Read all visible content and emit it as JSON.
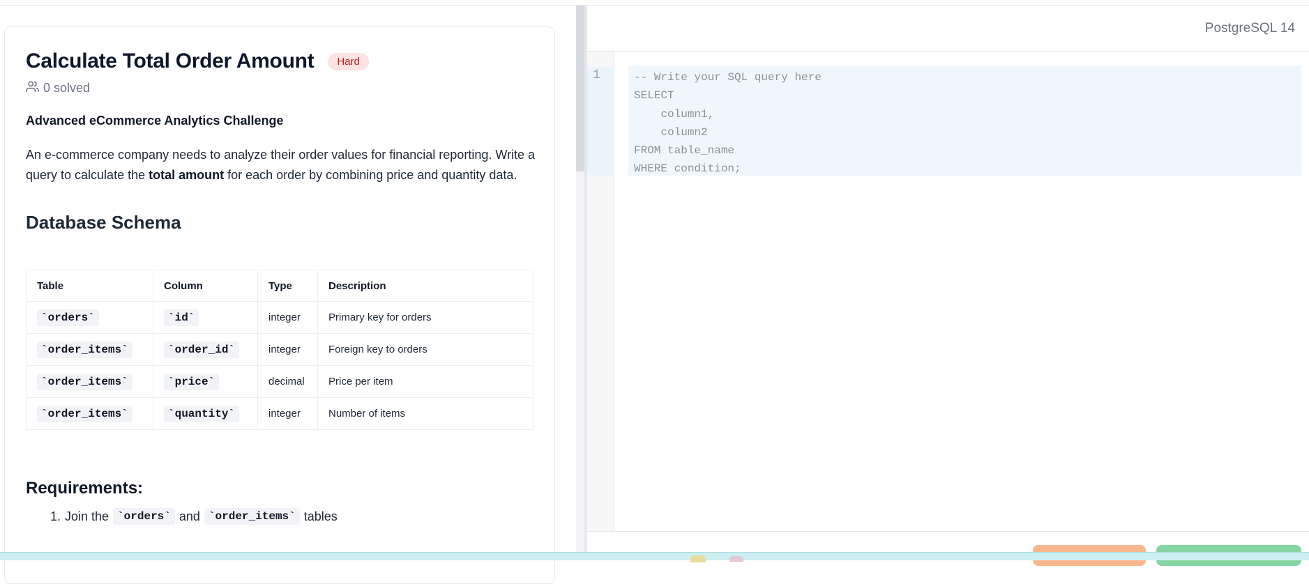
{
  "problem": {
    "title": "Calculate Total Order Amount",
    "difficulty": "Hard",
    "solved_text": "0 solved",
    "subtitle": "Advanced eCommerce Analytics Challenge",
    "desc_part1": "An e-commerce company needs to analyze their order values for financial reporting. Write a query to calculate the ",
    "desc_bold": "total amount",
    "desc_part2": " for each order by combining price and quantity data."
  },
  "schema": {
    "heading": "Database Schema",
    "headers": [
      "Table",
      "Column",
      "Type",
      "Description"
    ],
    "rows": [
      {
        "table": "`orders`",
        "column": "`id`",
        "type": "integer",
        "description": "Primary key for orders"
      },
      {
        "table": "`order_items`",
        "column": "`order_id`",
        "type": "integer",
        "description": "Foreign key to orders"
      },
      {
        "table": "`order_items`",
        "column": "`price`",
        "type": "decimal",
        "description": "Price per item"
      },
      {
        "table": "`order_items`",
        "column": "`quantity`",
        "type": "integer",
        "description": "Number of items"
      }
    ]
  },
  "requirements": {
    "heading": "Requirements:",
    "item1_num": "1.",
    "item1_pre": "Join the",
    "item1_code1": "`orders`",
    "item1_mid": "and",
    "item1_code2": "`order_items`",
    "item1_post": "tables"
  },
  "editor": {
    "language": "PostgreSQL 14",
    "line_number": "1",
    "code": "-- Write your SQL query here\nSELECT\n    column1,\n    column2\nFROM table_name\nWHERE condition;"
  },
  "icons": {
    "users": "users-icon"
  }
}
